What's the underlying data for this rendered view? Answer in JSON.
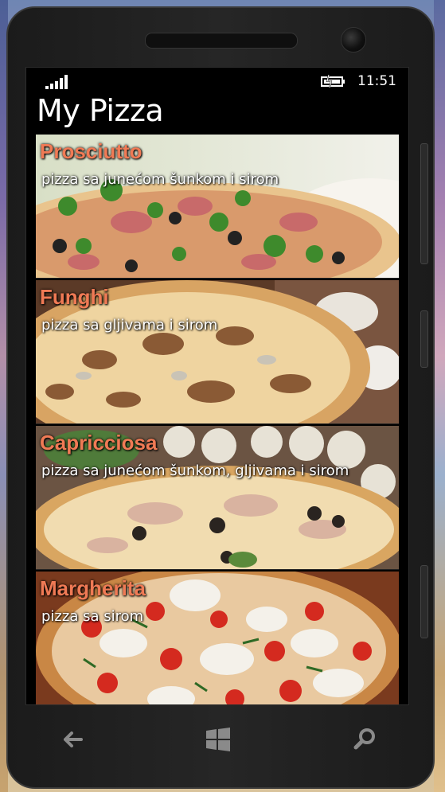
{
  "status_bar": {
    "time": "11:51",
    "signal_icon": "signal-bars-icon",
    "battery_icon": "battery-charging-icon"
  },
  "app": {
    "title": "My Pizza"
  },
  "pizzas": [
    {
      "name": "Prosciutto",
      "description": "pizza sa junećom šunkom i sirom"
    },
    {
      "name": "Funghi",
      "description": "pizza sa gljivama i sirom"
    },
    {
      "name": "Capricciosa",
      "description": "pizza sa junećom šunkom, gljivama i sirom"
    },
    {
      "name": "Margherita",
      "description": "pizza sa sirom"
    }
  ],
  "nav": {
    "back_icon": "back-arrow-icon",
    "start_icon": "windows-logo-icon",
    "search_icon": "search-icon"
  },
  "colors": {
    "accent": "#f07a55",
    "screen_bg": "#000000",
    "text": "#ffffff"
  }
}
